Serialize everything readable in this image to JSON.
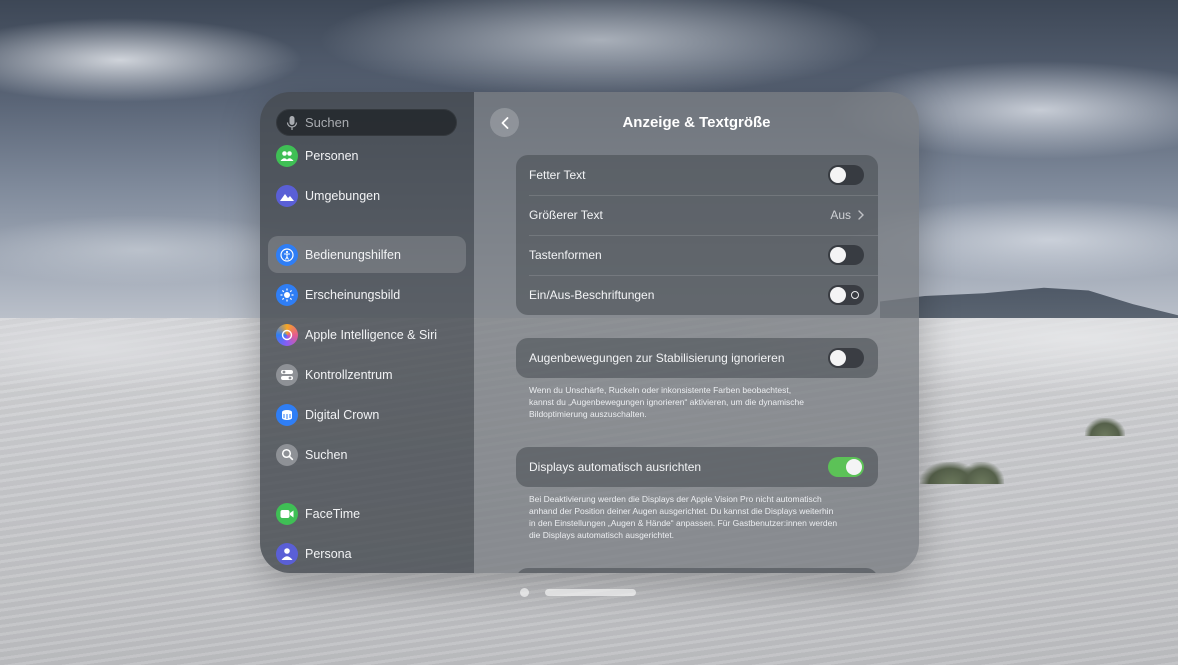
{
  "sidebar": {
    "search_placeholder": "Suchen",
    "items": [
      {
        "label": "Personen",
        "icon": "people-icon",
        "color": "#3fbf55"
      },
      {
        "label": "Umgebungen",
        "icon": "mountains-icon",
        "color": "#5a5fd6"
      },
      {
        "label": "Bedienungshilfen",
        "icon": "accessibility-icon",
        "color": "#2f7ef5",
        "selected": true
      },
      {
        "label": "Erscheinungsbild",
        "icon": "sun-icon",
        "color": "#2f7ef5"
      },
      {
        "label": "Apple Intelligence & Siri",
        "icon": "apple-intelligence-icon",
        "color": "#e55b8f"
      },
      {
        "label": "Kontrollzentrum",
        "icon": "switches-icon",
        "color": "#8e9196"
      },
      {
        "label": "Digital Crown",
        "icon": "digital-crown-icon",
        "color": "#2f7ef5"
      },
      {
        "label": "Suchen",
        "icon": "magnifier-icon",
        "color": "#8e9196"
      },
      {
        "label": "FaceTime",
        "icon": "video-camera-icon",
        "color": "#3fbf55"
      },
      {
        "label": "Persona",
        "icon": "persona-icon",
        "color": "#5a5fd6"
      }
    ]
  },
  "main": {
    "title": "Anzeige & Textgröße",
    "group1": [
      {
        "label": "Fetter Text",
        "toggle": false
      },
      {
        "label": "Größerer Text",
        "value": "Aus"
      },
      {
        "label": "Tastenformen",
        "toggle": false
      },
      {
        "label": "Ein/Aus-Beschriftungen",
        "toggle": false
      }
    ],
    "eye_stabilization": {
      "label": "Augenbewegungen zur Stabilisierung ignorieren",
      "toggle": false,
      "footnote_lines": [
        "Wenn du Unschärfe, Ruckeln oder inkonsistente Farben beobachtest,",
        "kannst du „Augenbewegungen ignorieren“ aktivieren, um die dynamische",
        "Bildoptimierung auszuschalten."
      ]
    },
    "auto_align": {
      "label": "Displays automatisch ausrichten",
      "toggle": true,
      "footnote_lines": [
        "Bei Deaktivierung werden die Displays der Apple Vision Pro nicht automatisch",
        "anhand der Position deiner Augen ausgerichtet. Du kannst die Displays weiterhin",
        "in den Einstellungen „Augen & Hände“ anpassen. Für Gastbenutzer:innen werden",
        "die Displays automatisch ausgerichtet."
      ]
    }
  },
  "colors": {
    "toggle_on": "#5cc257",
    "accent_blue": "#2f7ef5"
  }
}
